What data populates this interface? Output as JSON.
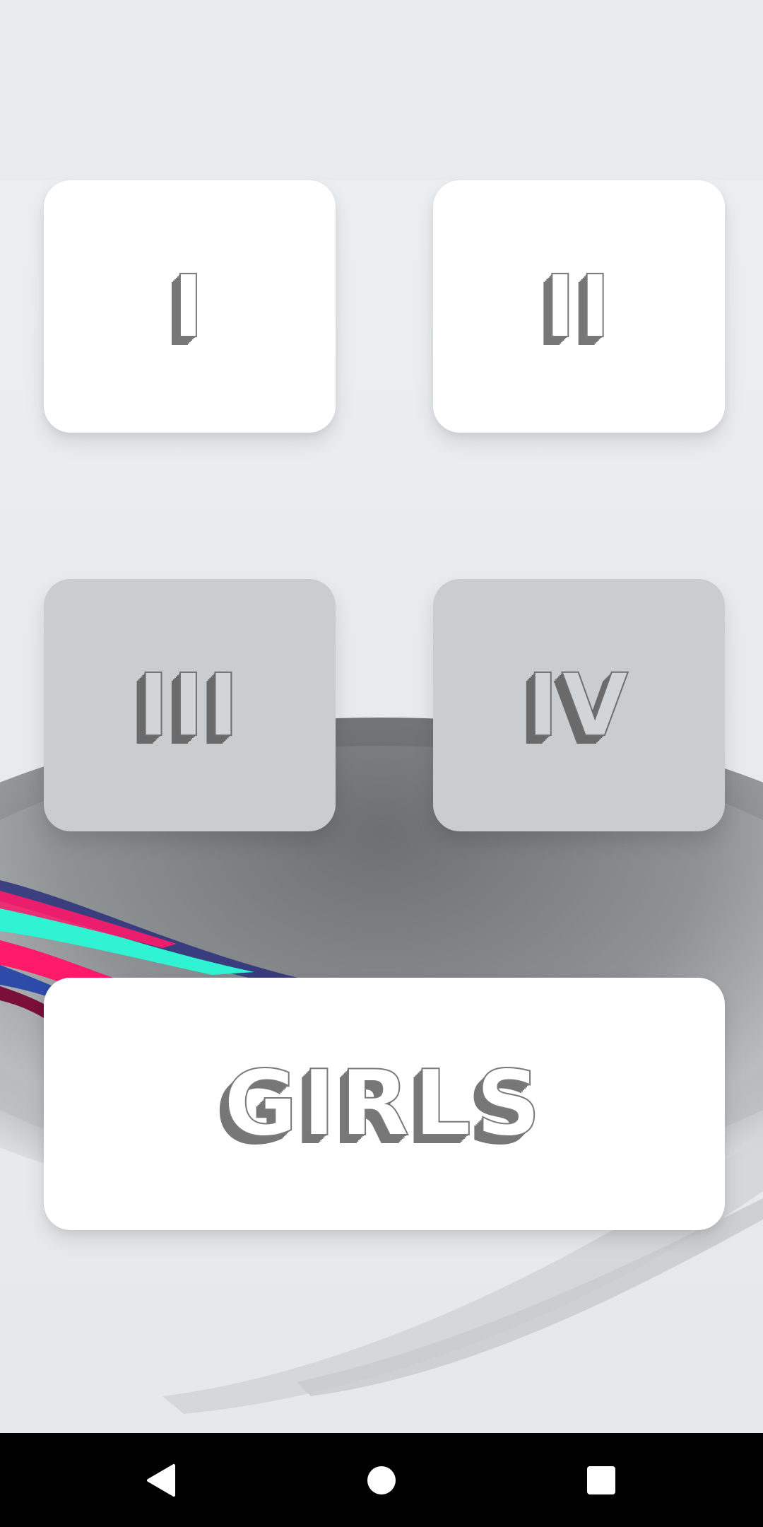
{
  "levels": [
    {
      "label": "I",
      "state": "unlocked"
    },
    {
      "label": "II",
      "state": "unlocked"
    },
    {
      "label": "III",
      "state": "locked"
    },
    {
      "label": "IV",
      "state": "locked"
    }
  ],
  "girls_button": {
    "label": "GIRLS"
  },
  "nav": {
    "back_icon": "triangle-back-icon",
    "home_icon": "circle-home-icon",
    "recents_icon": "square-recents-icon"
  },
  "colors": {
    "card_unlocked": "#ffffff",
    "card_locked": "#cacdcf",
    "background": "#e9ecee",
    "label_shadow": "#777777",
    "accent_cyan": "#2ff3d3",
    "accent_pink": "#ff1a6a",
    "accent_blue": "#2040a8"
  }
}
